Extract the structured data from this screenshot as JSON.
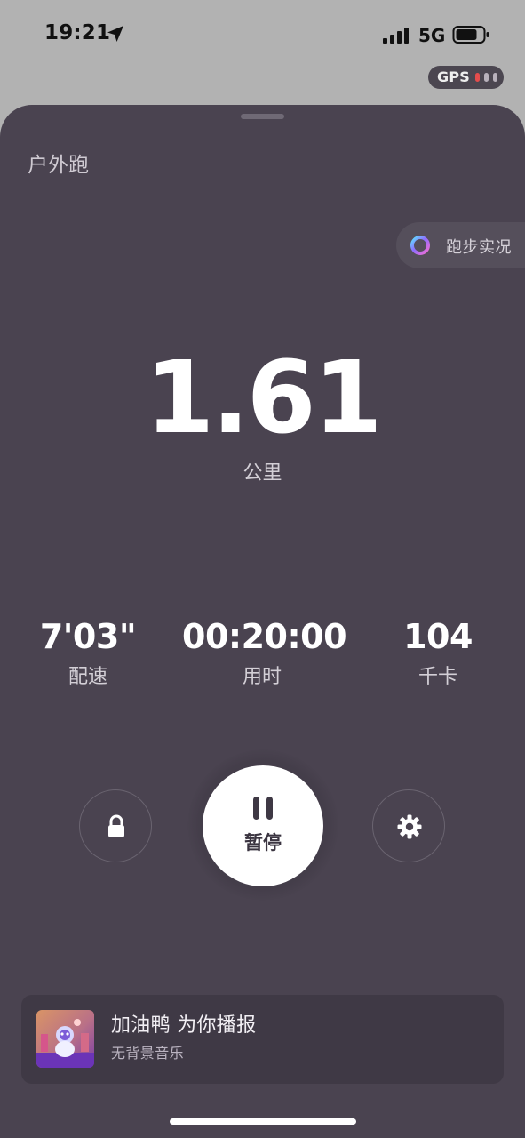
{
  "status_bar": {
    "time": "19:21",
    "network": "5G",
    "icons": {
      "location": "location-arrow-icon",
      "signal": "cellular-signal-icon",
      "battery": "battery-icon"
    }
  },
  "gps_indicator": {
    "label": "GPS",
    "signal_level": 1,
    "signal_max": 3,
    "accent_active": "#e44c4c",
    "accent_inactive": "#b8b1bb"
  },
  "sheet": {
    "title": "户外跑",
    "live_button": {
      "label": "跑步实况",
      "icon": "colorful-ring-icon"
    },
    "distance": {
      "value": "1.61",
      "unit": "公里"
    },
    "metrics": [
      {
        "value": "7'03\"",
        "label": "配速"
      },
      {
        "value": "00:20:00",
        "label": "用时"
      },
      {
        "value": "104",
        "label": "千卡"
      }
    ],
    "controls": {
      "lock_icon": "lock-icon",
      "pause_label": "暂停",
      "pause_icon": "pause-icon",
      "settings_icon": "gear-icon"
    },
    "music": {
      "title": "加油鸭 为你播报",
      "subtitle": "无背景音乐",
      "album_icon": "album-art"
    }
  },
  "colors": {
    "sheet_background": "#4a4350",
    "primary_text": "#ffffff",
    "secondary_text": "#d3cfd6"
  }
}
